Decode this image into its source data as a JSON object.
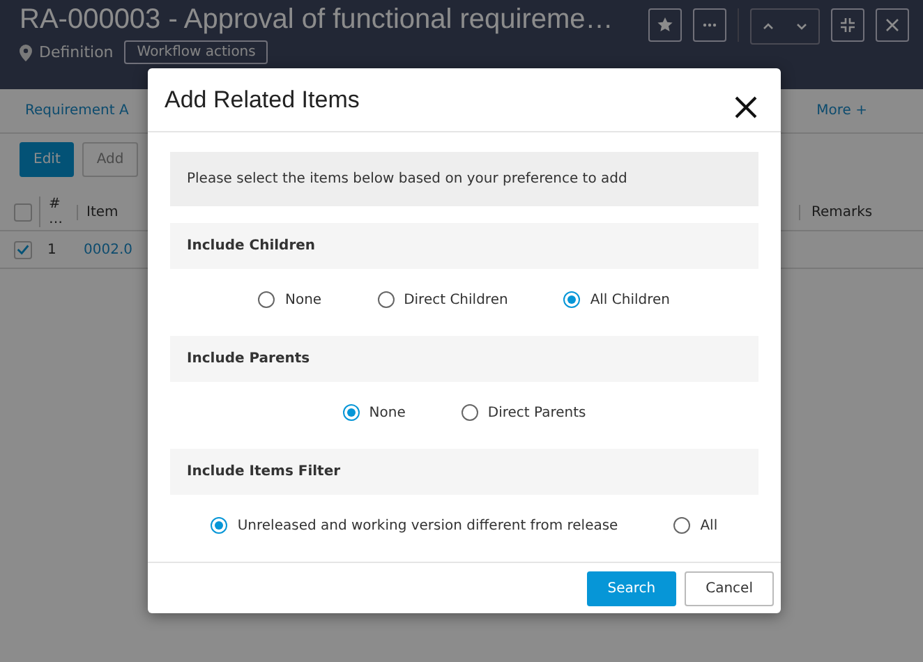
{
  "header": {
    "title": "RA-000003 - Approval of functional requireme…",
    "location": "Definition",
    "workflow_button": "Workflow actions"
  },
  "tabs": [
    {
      "label": "Requirement A"
    },
    {
      "label": "More +"
    }
  ],
  "toolbar": {
    "buttons": [
      {
        "label": "Edit",
        "kind": "primary"
      },
      {
        "label": "Add",
        "kind": "disabled"
      }
    ]
  },
  "table": {
    "columns": [
      "# …",
      "Item",
      "Remarks"
    ],
    "header_checked": false,
    "rows": [
      {
        "checked": true,
        "number": "1",
        "item": "0002.0"
      }
    ]
  },
  "dialog": {
    "title": "Add Related Items",
    "intro": "Please select the items below based on your preference to add",
    "sections": [
      {
        "heading": "Include Children",
        "options": [
          {
            "label": "None",
            "selected": false
          },
          {
            "label": "Direct Children",
            "selected": false
          },
          {
            "label": "All Children",
            "selected": true
          }
        ]
      },
      {
        "heading": "Include Parents",
        "options": [
          {
            "label": "None",
            "selected": true
          },
          {
            "label": "Direct Parents",
            "selected": false
          }
        ]
      },
      {
        "heading": "Include Items Filter",
        "options": [
          {
            "label": "Unreleased and working version different from release",
            "selected": true
          },
          {
            "label": "All",
            "selected": false
          }
        ]
      }
    ],
    "buttons": [
      {
        "label": "Search",
        "kind": "primary"
      },
      {
        "label": "Cancel",
        "kind": "secondary"
      }
    ]
  }
}
